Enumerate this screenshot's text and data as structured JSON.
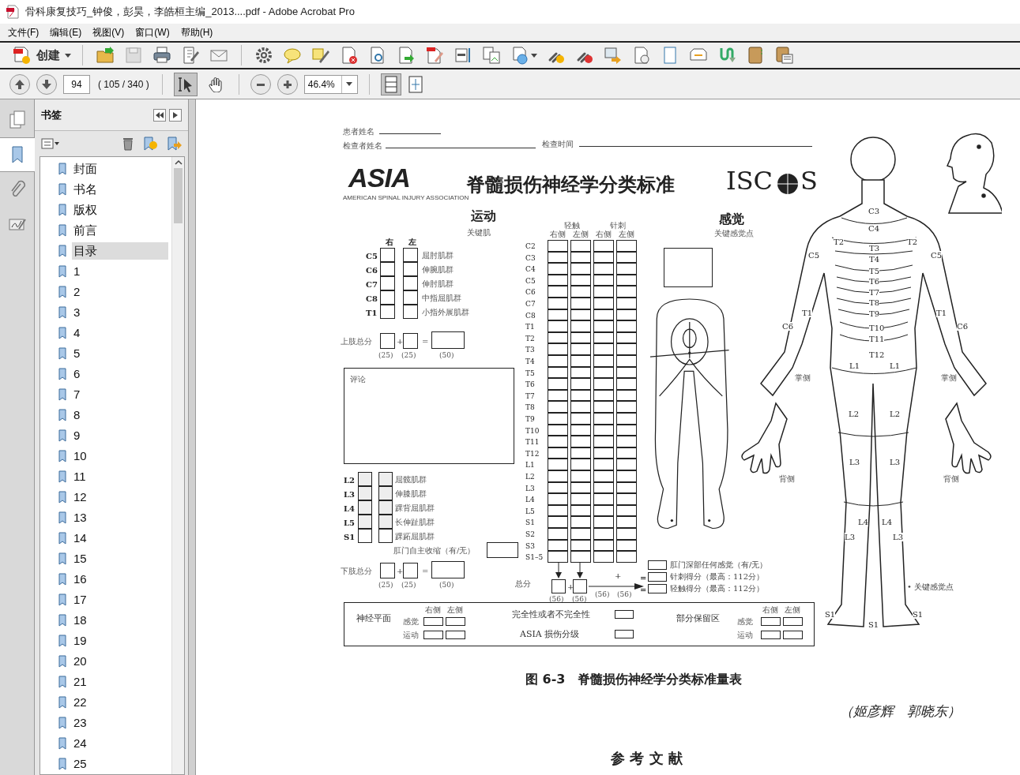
{
  "window": {
    "title": "骨科康复技巧_钟俊，彭昊，李皓桓主编_2013....pdf - Adobe Acrobat Pro"
  },
  "menu": [
    "文件(F)",
    "编辑(E)",
    "视图(V)",
    "窗口(W)",
    "帮助(H)"
  ],
  "toolbar": {
    "create_label": "创建"
  },
  "navigation": {
    "page": "94",
    "page_count": "( 105 / 340 )",
    "zoom": "46.4%",
    "tools": [
      {
        "kind": "select",
        "selected": true
      },
      {
        "kind": "hand",
        "selected": false
      }
    ]
  },
  "side_tabs": [
    {
      "kind": "pages",
      "selected": false
    },
    {
      "kind": "bookmarks",
      "selected": true
    },
    {
      "kind": "attachments",
      "selected": false
    },
    {
      "kind": "signatures",
      "selected": false
    }
  ],
  "bookmarks": {
    "title": "书签",
    "items": [
      {
        "label": "封面",
        "selected": false
      },
      {
        "label": "书名",
        "selected": false
      },
      {
        "label": "版权",
        "selected": false
      },
      {
        "label": "前言",
        "selected": false
      },
      {
        "label": "目录",
        "selected": true
      },
      {
        "label": "1",
        "selected": false
      },
      {
        "label": "2",
        "selected": false
      },
      {
        "label": "3",
        "selected": false
      },
      {
        "label": "4",
        "selected": false
      },
      {
        "label": "5",
        "selected": false
      },
      {
        "label": "6",
        "selected": false
      },
      {
        "label": "7",
        "selected": false
      },
      {
        "label": "8",
        "selected": false
      },
      {
        "label": "9",
        "selected": false
      },
      {
        "label": "10",
        "selected": false
      },
      {
        "label": "11",
        "selected": false
      },
      {
        "label": "12",
        "selected": false
      },
      {
        "label": "13",
        "selected": false
      },
      {
        "label": "14",
        "selected": false
      },
      {
        "label": "15",
        "selected": false
      },
      {
        "label": "16",
        "selected": false
      },
      {
        "label": "17",
        "selected": false
      },
      {
        "label": "18",
        "selected": false
      },
      {
        "label": "19",
        "selected": false
      },
      {
        "label": "20",
        "selected": false
      },
      {
        "label": "21",
        "selected": false
      },
      {
        "label": "22",
        "selected": false
      },
      {
        "label": "23",
        "selected": false
      },
      {
        "label": "24",
        "selected": false
      },
      {
        "label": "25",
        "selected": false
      }
    ]
  },
  "document": {
    "header_fields": [
      "患者姓名",
      "检查者姓名",
      "检查时间"
    ],
    "asia_logo": "ASIA",
    "asia_subtitle": "AMERICAN SPINAL INJURY ASSOCIATION",
    "title": "脊髓损伤神经学分类标准",
    "iscos_logo": [
      "ISC",
      "S"
    ],
    "motor": {
      "heading": "运动",
      "subheading": "关键肌",
      "sides": [
        "右",
        "左"
      ],
      "upper_rows": [
        {
          "level": "C5",
          "muscle": "屈肘肌群"
        },
        {
          "level": "C6",
          "muscle": "伸腕肌群"
        },
        {
          "level": "C7",
          "muscle": "伸肘肌群"
        },
        {
          "level": "C8",
          "muscle": "中指屈肌群"
        },
        {
          "level": "T1",
          "muscle": "小指外展肌群"
        }
      ],
      "upper_total": {
        "label": "上肢总分",
        "operators": [
          "+",
          "="
        ],
        "maxima": [
          "(25)",
          "(25)",
          "(50)"
        ]
      },
      "comment_label": "评论",
      "lower_rows": [
        {
          "level": "L2",
          "muscle": "屈髋肌群"
        },
        {
          "level": "L3",
          "muscle": "伸膝肌群"
        },
        {
          "level": "L4",
          "muscle": "踝背屈肌群"
        },
        {
          "level": "L5",
          "muscle": "长伸趾肌群"
        },
        {
          "level": "S1",
          "muscle": "踝跖屈肌群"
        }
      ],
      "anal_contraction": "肛门自主收缩（有/无）",
      "lower_total": {
        "label": "下肢总分",
        "operators": [
          "+",
          "="
        ],
        "maxima": [
          "(25)",
          "(25)",
          "(50)"
        ]
      }
    },
    "sensory_grid": {
      "groups": [
        "轻触",
        "针刺"
      ],
      "columns": [
        "右侧",
        "左侧",
        "右侧",
        "左侧"
      ],
      "levels": [
        "C2",
        "C3",
        "C4",
        "C5",
        "C6",
        "C7",
        "C8",
        "T1",
        "T2",
        "T3",
        "T4",
        "T5",
        "T6",
        "T7",
        "T8",
        "T9",
        "T10",
        "T11",
        "T12",
        "L1",
        "L2",
        "L3",
        "L4",
        "L5",
        "S1",
        "S2",
        "S3",
        "S1–5"
      ],
      "total_label": "总分",
      "total_operator": "+",
      "sum_operator": "+",
      "maxima": [
        "(56)",
        "(56)",
        "(56)",
        "(56)"
      ],
      "result_operators": [
        "=",
        "="
      ],
      "results": [
        "肛门深部任何感觉（有/无）",
        "针刺得分（最高：112分）",
        "轻触得分（最高：112分）"
      ]
    },
    "summary": {
      "neuro_level": "神经平面",
      "rows": [
        "感觉",
        "运动"
      ],
      "sides": [
        "右侧",
        "左侧"
      ],
      "completeness": "完全性或者不完全性",
      "asia_grade": "ASIA 损伤分级",
      "zone": "部分保留区",
      "zone_rows": [
        "感觉",
        "运动"
      ],
      "zone_sides": [
        "右侧",
        "左侧"
      ]
    },
    "sensory": {
      "heading": "感觉",
      "subheading": "关键感觉点",
      "hand_labels": [
        "掌侧",
        "掌侧",
        "背侧",
        "背侧"
      ],
      "key_point_legend": "• 关键感觉点",
      "body_labels": [
        "C3",
        "C4",
        "T2",
        "T2",
        "C5",
        "C5",
        "T3",
        "T4",
        "T5",
        "T6",
        "T7",
        "T8",
        "T9",
        "T10",
        "T11",
        "T12",
        "T1",
        "T1",
        "C6",
        "C6",
        "L1",
        "L1",
        "L2",
        "L2",
        "L3",
        "L3",
        "L4",
        "L4",
        "L3",
        "L3",
        "S1",
        "S1",
        "S1"
      ]
    },
    "caption": "图 6-3　脊髓损伤神经学分类标准量表",
    "authors": "（姬彦辉　郭晓东）",
    "next_heading": "参 考 文 献"
  }
}
